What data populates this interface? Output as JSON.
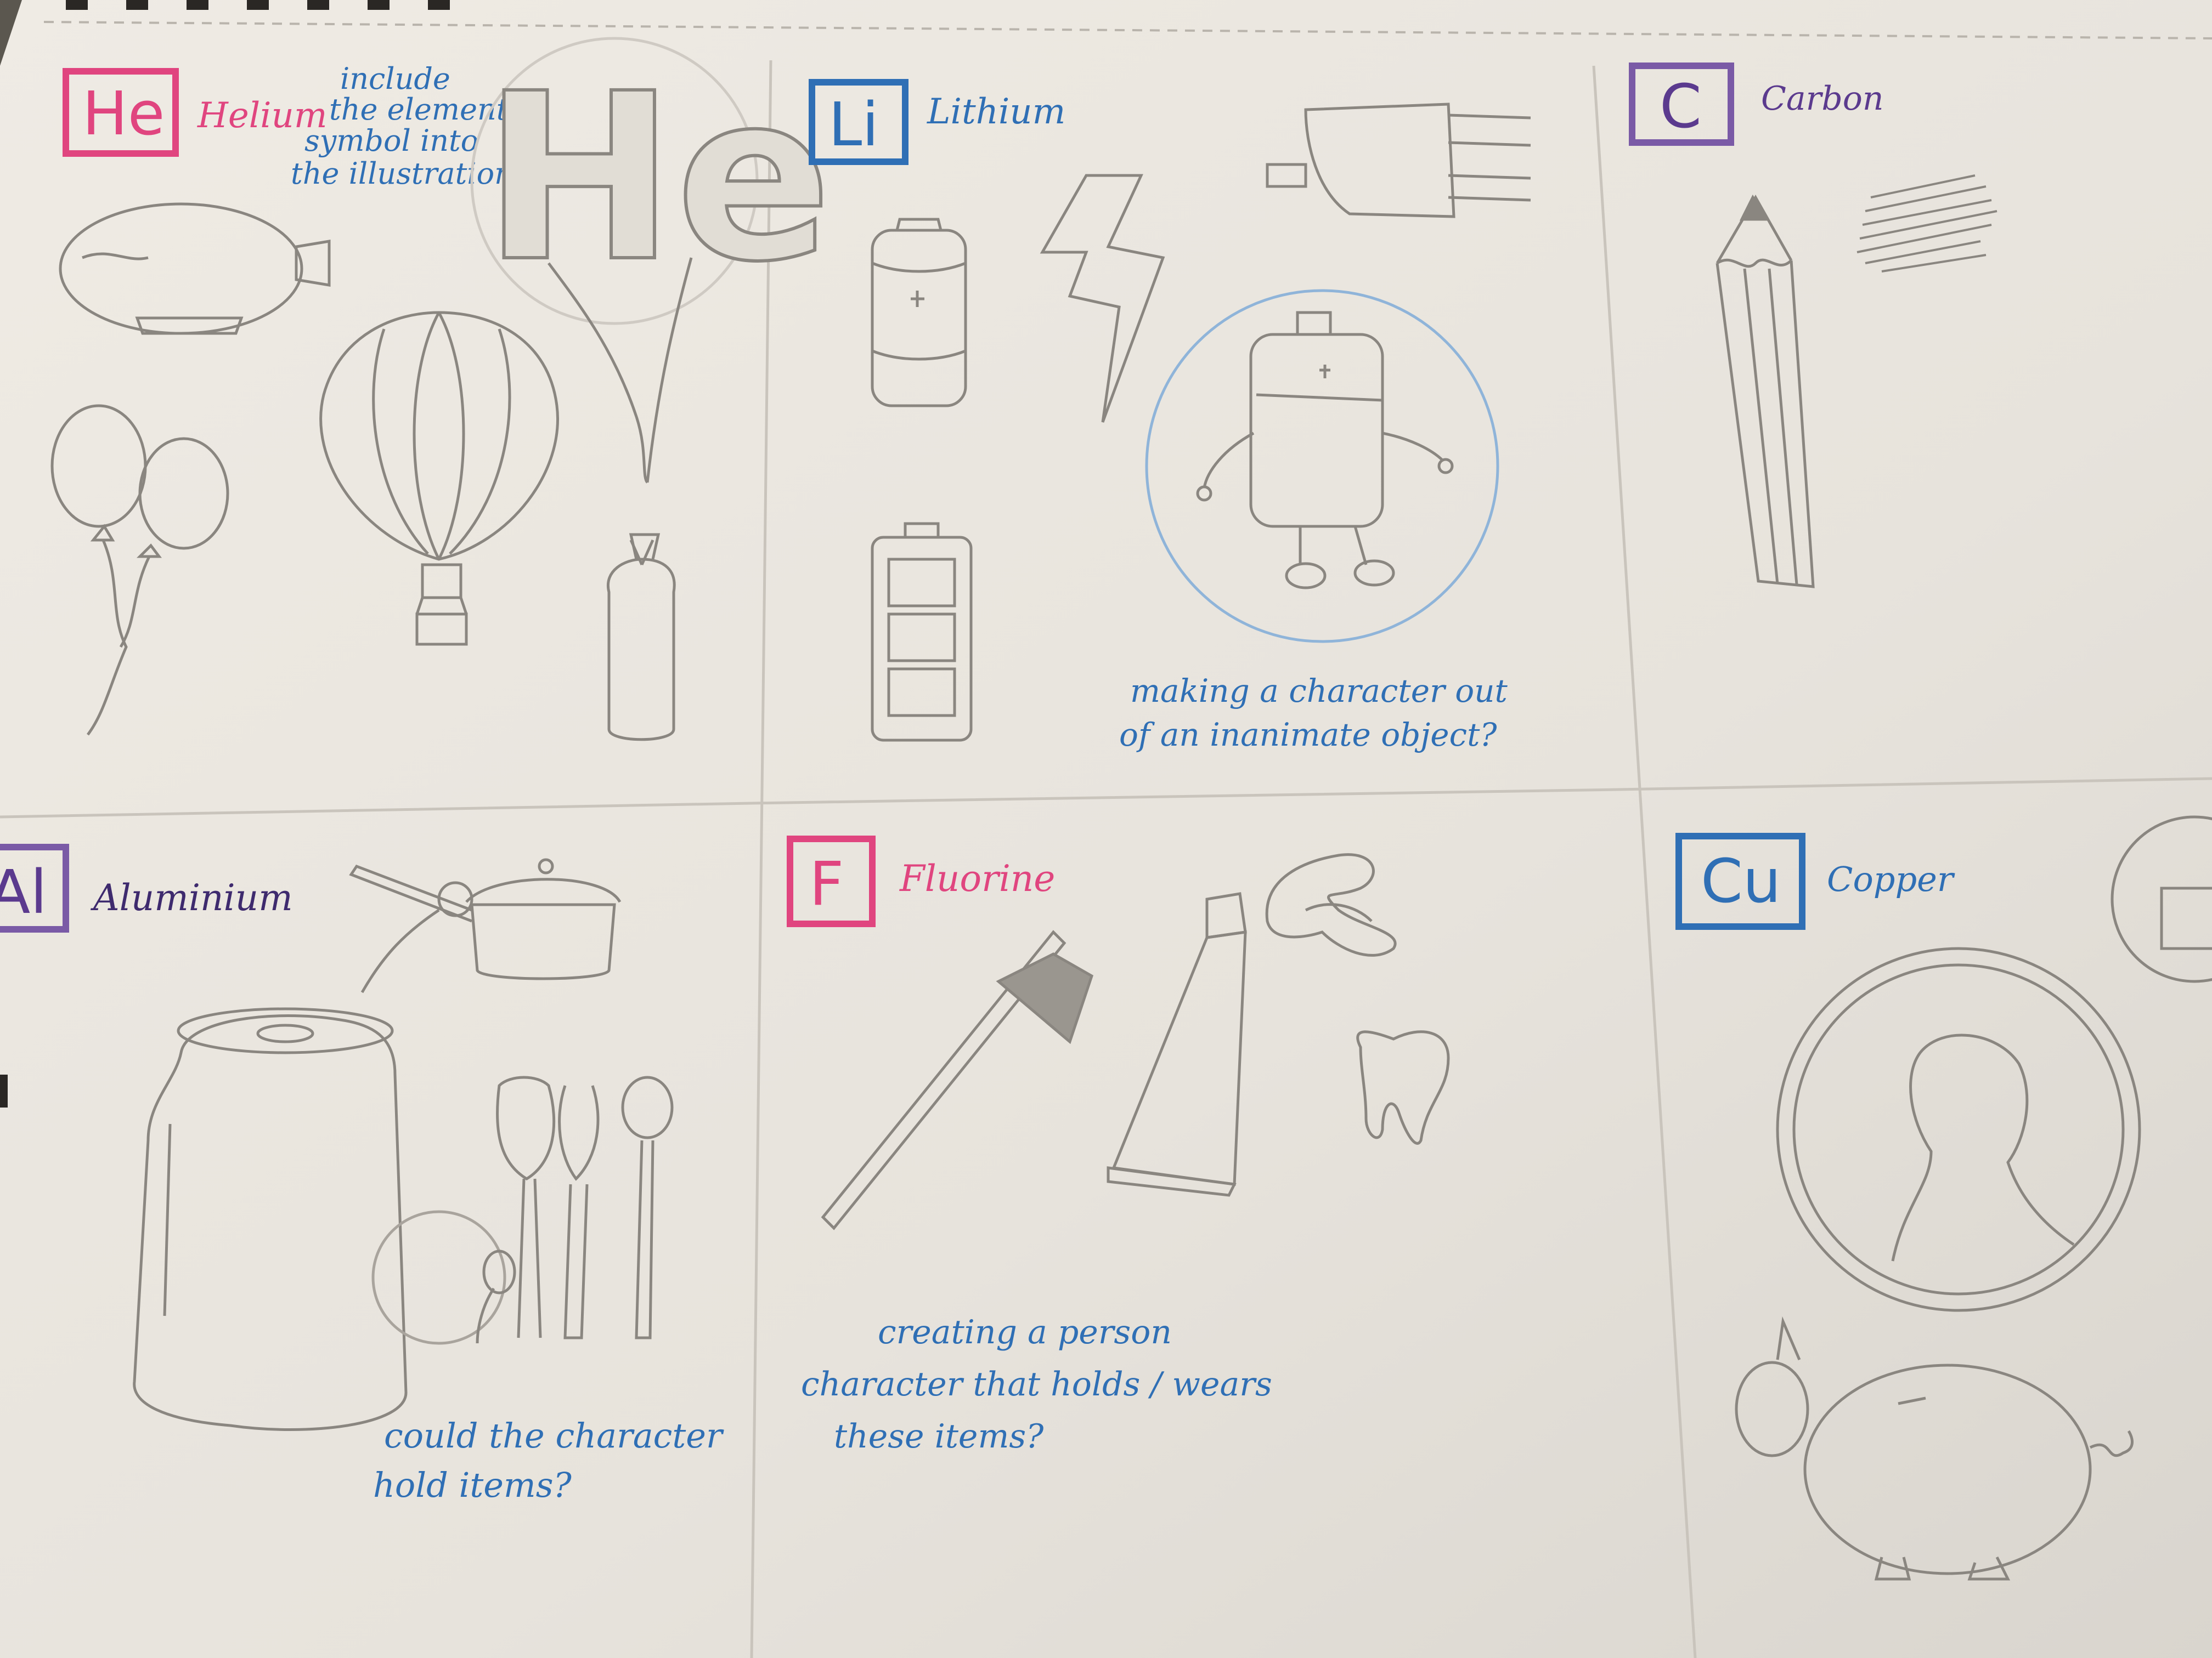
{
  "colors": {
    "paper": "#eae6df",
    "pencil": "#8a8680",
    "pink": "#e0457f",
    "blue": "#2f6fb5",
    "purple": "#5b3a8e",
    "violet": "#7a5aa6"
  },
  "cells": [
    {
      "symbol": "He",
      "name": "Helium",
      "symbol_color": "pink",
      "note": [
        "include",
        "the element",
        "symbol into",
        "the illustration"
      ],
      "drawings": [
        "blimp",
        "hot-air-balloon",
        "balloons",
        "gas-cylinder",
        "he-letter-balloon"
      ]
    },
    {
      "symbol": "Li",
      "name": "Lithium",
      "symbol_color": "blue",
      "note": [
        "making a character out",
        "of an inanimate object?"
      ],
      "drawings": [
        "battery",
        "lightning-bolt",
        "plug",
        "battery-character",
        "battery-level"
      ]
    },
    {
      "symbol": "C",
      "name": "Carbon",
      "symbol_color": "purple",
      "drawings": [
        "pencil",
        "pencil-scribble"
      ]
    },
    {
      "symbol": "Al",
      "name": "Aluminium",
      "symbol_color": "purple",
      "note": [
        "could the character",
        "hold items?"
      ],
      "drawings": [
        "saucepan",
        "soda-can",
        "kitchen-utensils"
      ]
    },
    {
      "symbol": "F",
      "name": "Fluorine",
      "symbol_color": "pink",
      "note": [
        "creating a person",
        "character that holds / wears",
        "these items?"
      ],
      "drawings": [
        "toothbrush",
        "toothpaste-tube",
        "toothpaste-swirl",
        "tooth"
      ]
    },
    {
      "symbol": "Cu",
      "name": "Copper",
      "symbol_color": "blue",
      "drawings": [
        "penny-coin",
        "piggy-bank",
        "copper-badge-partial"
      ]
    }
  ],
  "he_letters": "He"
}
